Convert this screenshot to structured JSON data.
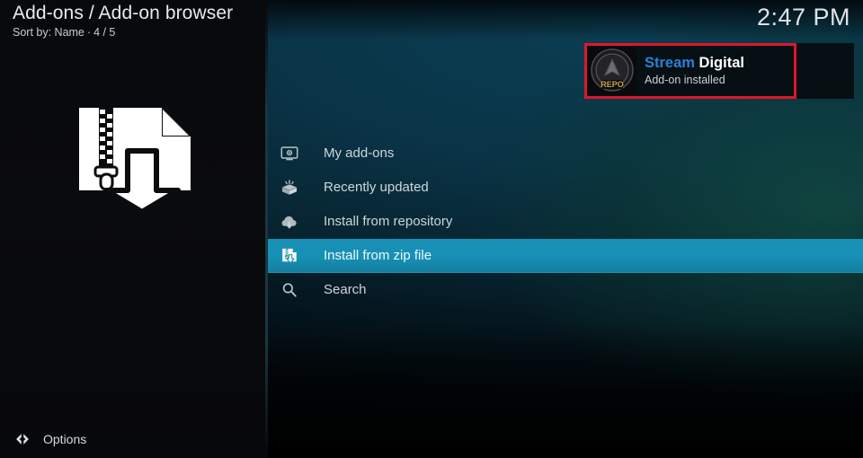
{
  "header": {
    "title": "Add-ons / Add-on browser",
    "sort_label": "Sort by: Name",
    "separator": "·",
    "count": "4 / 5"
  },
  "clock": {
    "time": "2:47 PM"
  },
  "hero": {
    "icon": "zip-file-download-icon"
  },
  "menu": {
    "items": [
      {
        "label": "My add-ons",
        "icon": "monitor-gear-icon",
        "selected": false
      },
      {
        "label": "Recently updated",
        "icon": "open-box-icon",
        "selected": false
      },
      {
        "label": "Install from repository",
        "icon": "cloud-download-icon",
        "selected": false
      },
      {
        "label": "Install from zip file",
        "icon": "zip-download-icon",
        "selected": true
      },
      {
        "label": "Search",
        "icon": "magnifier-icon",
        "selected": false
      }
    ]
  },
  "toast": {
    "title_primary": "Stream",
    "title_secondary": "Digital",
    "status": "Add-on installed",
    "thumb_label": "REPO",
    "thumb_icon": "repo-logo-icon"
  },
  "footer": {
    "options_label": "Options",
    "options_icon": "left-right-arrows-icon"
  },
  "colors": {
    "accent": "#1a8fb4",
    "annotation": "#e0162b",
    "title_primary": "#2b80d6",
    "panel_dark": "#08090b"
  }
}
